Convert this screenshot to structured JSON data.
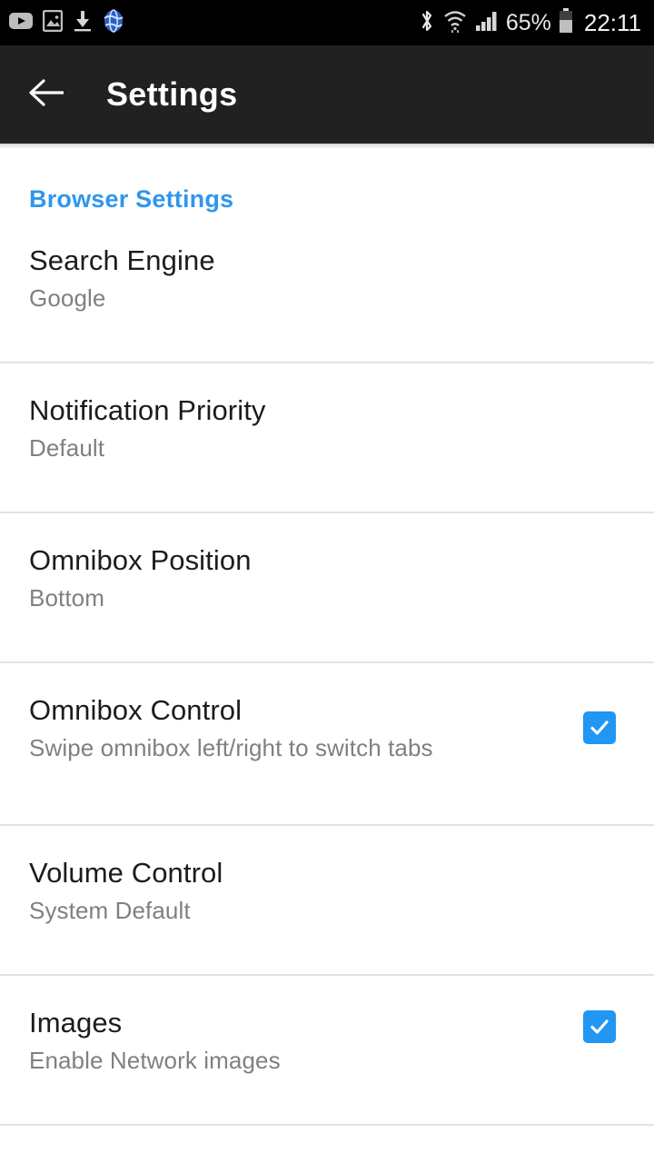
{
  "statusbar": {
    "icons": [
      "youtube-icon",
      "image-icon",
      "download-icon",
      "globe-icon",
      "bluetooth-icon",
      "wifi-icon",
      "signal-icon",
      "battery-icon"
    ],
    "battery": "65%",
    "time": "22:11"
  },
  "appbar": {
    "back_label": "back-arrow",
    "title": "Settings"
  },
  "section": {
    "header": "Browser Settings"
  },
  "rows": [
    {
      "title": "Search Engine",
      "subtitle": "Google",
      "checkbox": null
    },
    {
      "title": "Notification Priority",
      "subtitle": "Default",
      "checkbox": null
    },
    {
      "title": "Omnibox Position",
      "subtitle": "Bottom",
      "checkbox": null
    },
    {
      "title": "Omnibox Control",
      "subtitle": "Swipe omnibox left/right to switch tabs",
      "checkbox": "checked"
    },
    {
      "title": "Volume Control",
      "subtitle": "System Default",
      "checkbox": null
    },
    {
      "title": "Images",
      "subtitle": "Enable Network images",
      "checkbox": "checked"
    }
  ],
  "colors": {
    "accent": "#2f96ee",
    "checkbox": "#2196f3",
    "appbar": "#212121",
    "statusbar": "#000000",
    "title_text": "#1c1c1c",
    "subtitle_text": "#808080",
    "divider": "#e3e3e3"
  }
}
